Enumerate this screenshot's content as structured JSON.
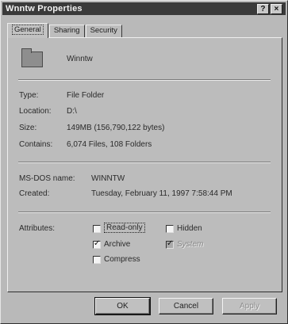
{
  "window": {
    "title": "Wnntw Properties",
    "help_button": "?",
    "close_button": "×"
  },
  "tabs": [
    {
      "label": "General",
      "active": true
    },
    {
      "label": "Sharing",
      "active": false
    },
    {
      "label": "Security",
      "active": false
    }
  ],
  "folder": {
    "name": "Winntw",
    "icon": "folder-icon"
  },
  "details": {
    "type_label": "Type:",
    "type_value": "File Folder",
    "location_label": "Location:",
    "location_value": "D:\\",
    "size_label": "Size:",
    "size_value": "149MB (156,790,122 bytes)",
    "contains_label": "Contains:",
    "contains_value": "6,074 Files, 108 Folders",
    "msdos_label": "MS-DOS name:",
    "msdos_value": "WINNTW",
    "created_label": "Created:",
    "created_value": "Tuesday, February 11, 1997 7:58:44 PM"
  },
  "attributes": {
    "label": "Attributes:",
    "read_only": {
      "label": "Read-only",
      "checked": false
    },
    "hidden": {
      "label": "Hidden",
      "checked": false
    },
    "archive": {
      "label": "Archive",
      "checked": true
    },
    "system": {
      "label": "System",
      "checked": true
    },
    "compress": {
      "label": "Compress",
      "checked": false
    }
  },
  "buttons": {
    "ok": "OK",
    "cancel": "Cancel",
    "apply": "Apply"
  }
}
